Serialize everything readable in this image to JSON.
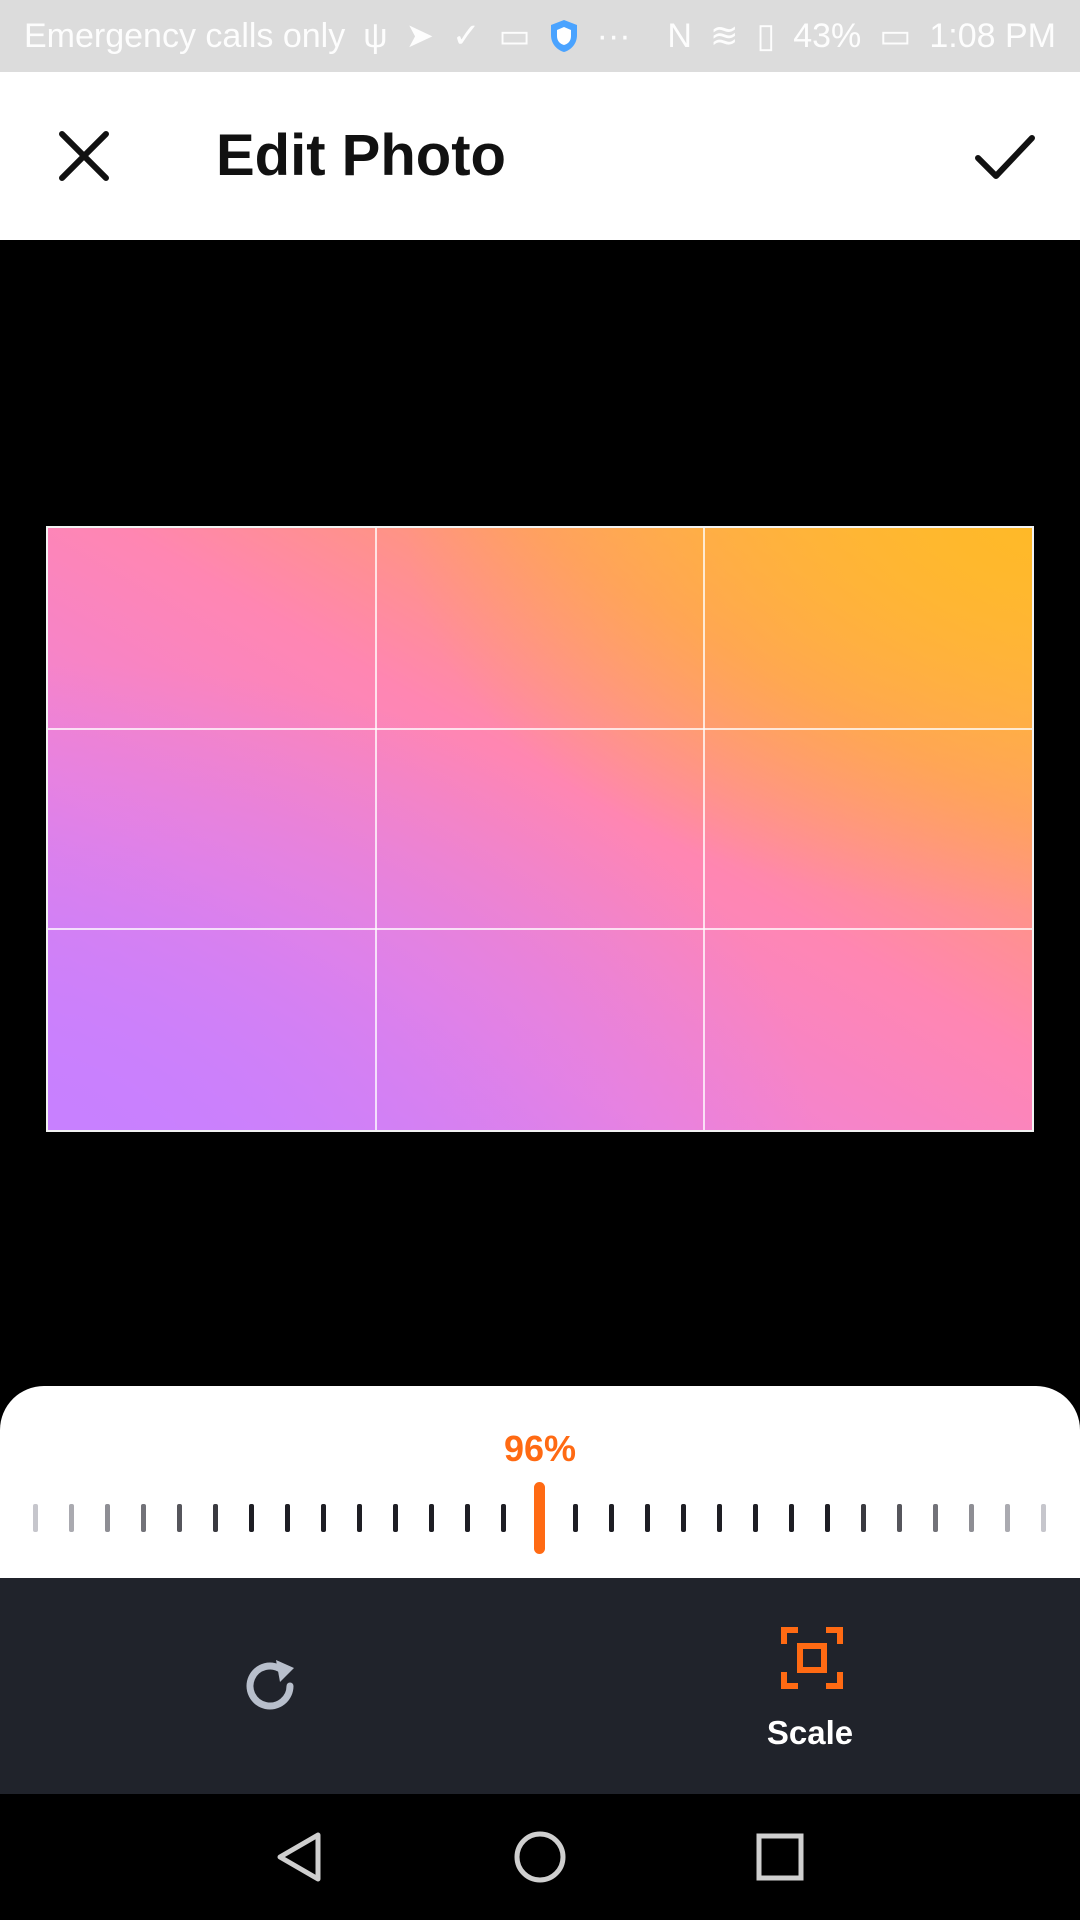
{
  "status_bar": {
    "carrier_text": "Emergency calls only",
    "battery": "43%",
    "time": "1:08 PM",
    "icons": [
      "usb-icon",
      "send-icon",
      "download-done-icon",
      "screen-icon",
      "shield-icon",
      "more-icon",
      "nfc-icon",
      "wifi-icon",
      "sim-icon",
      "battery-icon"
    ]
  },
  "header": {
    "title": "Edit Photo",
    "close_icon": "close-icon",
    "confirm_icon": "check-icon"
  },
  "photo": {
    "gradient_colors": [
      "#c77dff",
      "#f082d8",
      "#ff86b2",
      "#ff9a70",
      "#ffb844"
    ]
  },
  "scale": {
    "value_label": "96%",
    "value": 0.96,
    "accent_color": "#ff6a13"
  },
  "toolbar": {
    "rotate_icon": "rotate-icon",
    "scale_icon": "scale-icon",
    "scale_label": "Scale",
    "background": "#20232b"
  },
  "nav_bar": {
    "icons": [
      "back-icon",
      "home-icon",
      "recents-icon"
    ]
  }
}
